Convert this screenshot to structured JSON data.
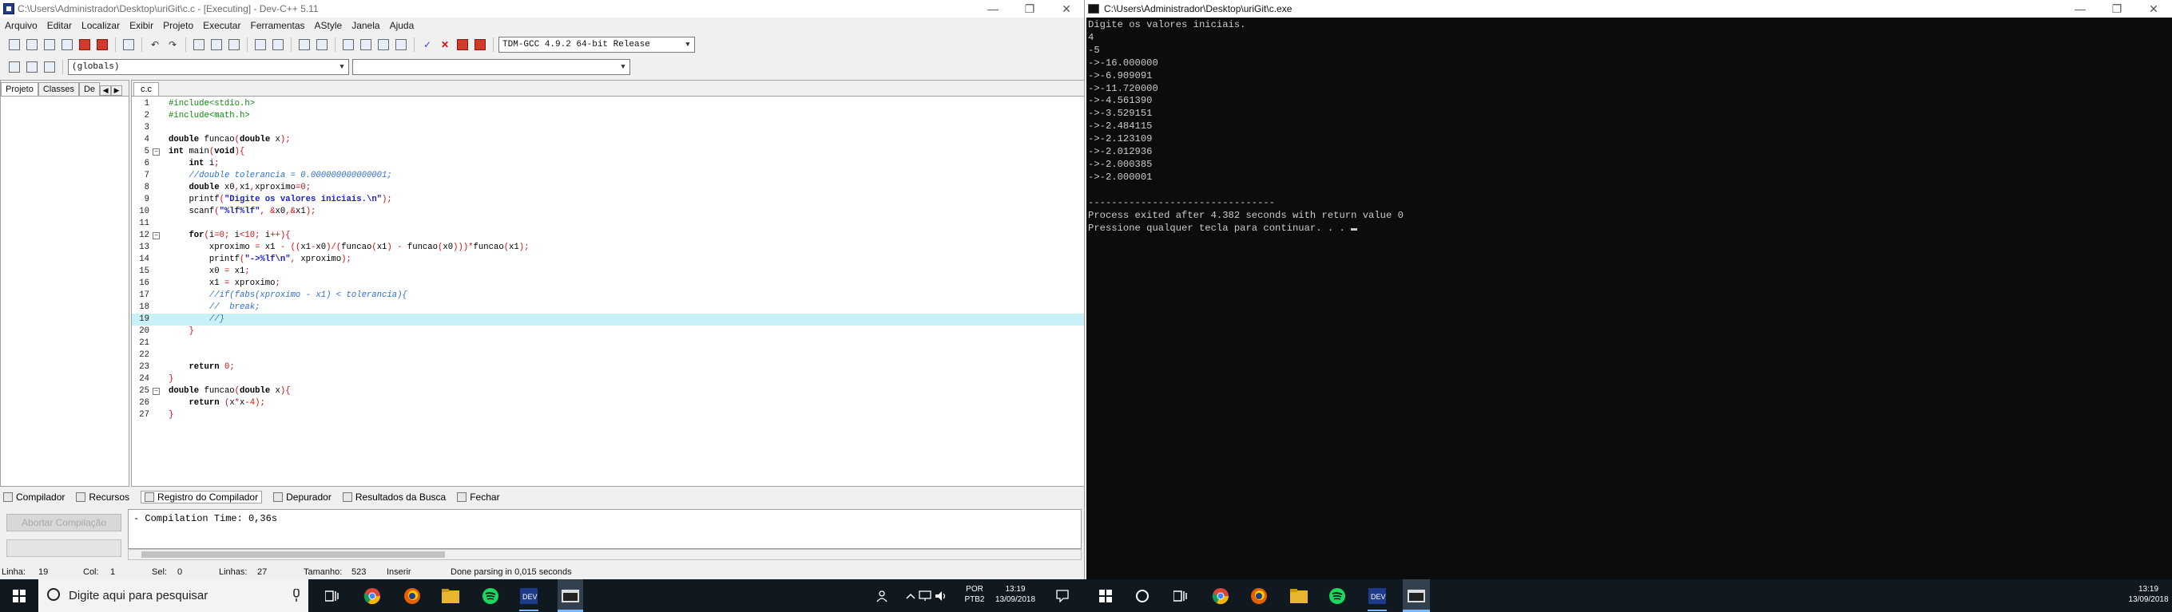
{
  "devcpp": {
    "title": "C:\\Users\\Administrador\\Desktop\\uriGit\\c.c - [Executing] - Dev-C++ 5.11",
    "menu": [
      "Arquivo",
      "Editar",
      "Localizar",
      "Exibir",
      "Projeto",
      "Executar",
      "Ferramentas",
      "AStyle",
      "Janela",
      "Ajuda"
    ],
    "compiler_select": "TDM-GCC 4.9.2 64-bit Release",
    "scope_select": "(globals)",
    "left_tabs": [
      "Projeto",
      "Classes",
      "De"
    ],
    "editor_tab": "c.c",
    "code_lines": [
      {
        "n": "1",
        "t": "#include<stdio.h>"
      },
      {
        "n": "2",
        "t": "#include<math.h>"
      },
      {
        "n": "3",
        "t": ""
      },
      {
        "n": "4",
        "t": "double funcao(double x);"
      },
      {
        "n": "5",
        "t": "int main(void){"
      },
      {
        "n": "6",
        "t": "    int i;"
      },
      {
        "n": "7",
        "t": "    //double tolerancia = 0.000000000000001;"
      },
      {
        "n": "8",
        "t": "    double x0,x1,xproximo=0;"
      },
      {
        "n": "9",
        "t": "    printf(\"Digite os valores iniciais.\\n\");"
      },
      {
        "n": "10",
        "t": "    scanf(\"%lf%lf\", &x0,&x1);"
      },
      {
        "n": "11",
        "t": ""
      },
      {
        "n": "12",
        "t": "    for(i=0; i<10; i++){"
      },
      {
        "n": "13",
        "t": "        xproximo = x1 - ((x1-x0)/(funcao(x1) - funcao(x0)))*funcao(x1);"
      },
      {
        "n": "14",
        "t": "        printf(\"->%lf\\n\", xproximo);"
      },
      {
        "n": "15",
        "t": "        x0 = x1;"
      },
      {
        "n": "16",
        "t": "        x1 = xproximo;"
      },
      {
        "n": "17",
        "t": "        //if(fabs(xproximo - x1) < tolerancia){"
      },
      {
        "n": "18",
        "t": "        //  break;"
      },
      {
        "n": "19",
        "t": "        //}"
      },
      {
        "n": "20",
        "t": "    }"
      },
      {
        "n": "21",
        "t": ""
      },
      {
        "n": "22",
        "t": ""
      },
      {
        "n": "23",
        "t": "    return 0;"
      },
      {
        "n": "24",
        "t": "}"
      },
      {
        "n": "25",
        "t": "double funcao(double x){"
      },
      {
        "n": "26",
        "t": "    return (x*x-4);"
      },
      {
        "n": "27",
        "t": "}"
      }
    ],
    "bottom_tabs": [
      "Compilador",
      "Recursos",
      "Registro do Compilador",
      "Depurador",
      "Resultados da Busca",
      "Fechar"
    ],
    "abort_button": "Abortar Compilação",
    "compile_log": "- Compilation Time: 0,36s",
    "status": {
      "line_label": "Linha:",
      "line": "19",
      "col_label": "Col:",
      "col": "1",
      "sel_label": "Sel:",
      "sel": "0",
      "lines_label": "Linhas:",
      "lines": "27",
      "size_label": "Tamanho:",
      "size": "523",
      "mode": "Inserir",
      "parse": "Done parsing in 0,015 seconds"
    }
  },
  "console": {
    "title": "C:\\Users\\Administrador\\Desktop\\uriGit\\c.exe",
    "output": "Digite os valores iniciais.\n4\n-5\n->-16.000000\n->-6.909091\n->-11.720000\n->-4.561390\n->-3.529151\n->-2.484115\n->-2.123109\n->-2.012936\n->-2.000385\n->-2.000001\n\n--------------------------------\nProcess exited after 4.382 seconds with return value 0\nPressione qualquer tecla para continuar. . . "
  },
  "taskbar_left": {
    "search_placeholder": "Digite aqui para pesquisar",
    "lang": "POR",
    "layout": "PTB2",
    "time": "13:19",
    "date": "13/09/2018"
  },
  "taskbar_right": {
    "time": "13:19",
    "date": "13/09/2018"
  },
  "icons": [
    "windows-start-icon",
    "search-icon",
    "microphone-icon",
    "task-view-icon",
    "chrome-icon",
    "firefox-icon",
    "file-explorer-icon",
    "spotify-icon",
    "devcpp-icon",
    "console-icon",
    "people-icon",
    "chevron-up-icon",
    "network-icon",
    "volume-icon",
    "notification-icon"
  ],
  "colors": {
    "console_bg": "#0c0c0c",
    "console_fg": "#cccccc",
    "highlight_line": "#c9f2f8",
    "taskbar": "#101820"
  }
}
